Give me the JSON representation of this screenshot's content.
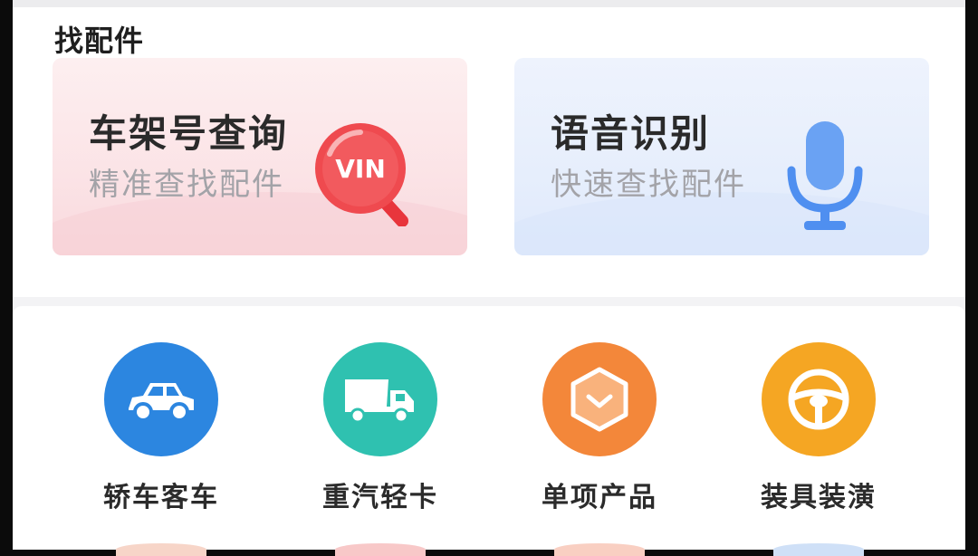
{
  "section": {
    "title": "找配件"
  },
  "cards": [
    {
      "title": "车架号查询",
      "subtitle": "精准查找配件",
      "icon": "vin-magnifier-icon",
      "badge_text": "VIN",
      "accent": "#ef4a4f"
    },
    {
      "title": "语音识别",
      "subtitle": "快速查找配件",
      "icon": "microphone-icon",
      "accent": "#4f8ff0"
    }
  ],
  "categories": [
    {
      "label": "轿车客车",
      "icon": "car-icon",
      "color": "#2c86e0"
    },
    {
      "label": "重汽轻卡",
      "icon": "truck-icon",
      "color": "#2fc1b0"
    },
    {
      "label": "单项产品",
      "icon": "box-icon",
      "color": "#f3873a"
    },
    {
      "label": "装具装潢",
      "icon": "steering-wheel-icon",
      "color": "#f5a623"
    }
  ]
}
